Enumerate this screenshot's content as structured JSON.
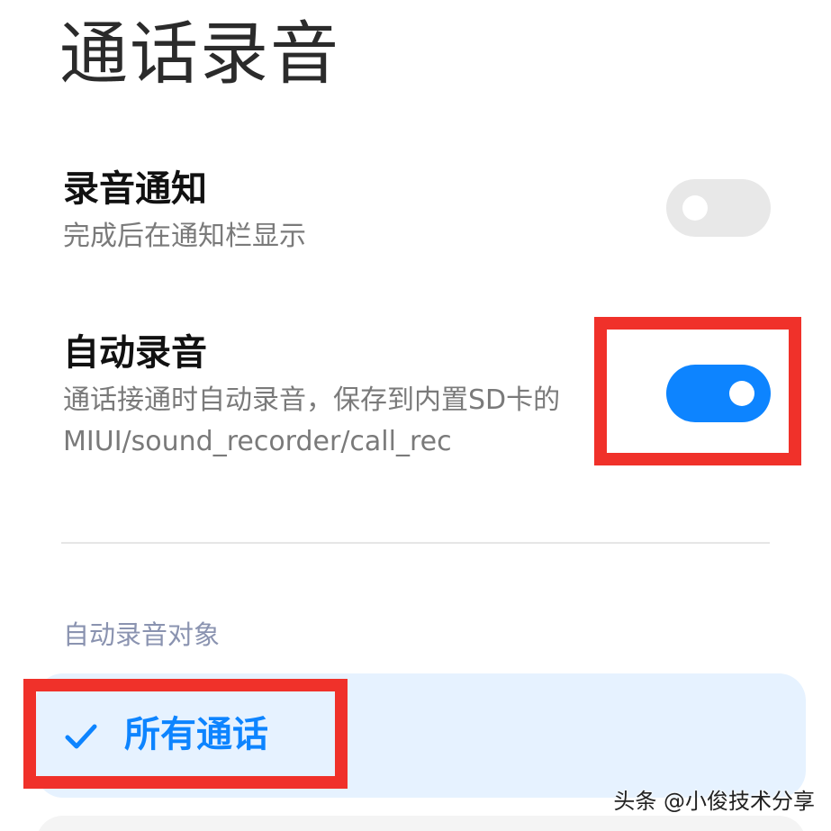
{
  "header": {
    "title": "通话录音"
  },
  "settings": {
    "record_notification": {
      "title": "录音通知",
      "description": "完成后在通知栏显示",
      "enabled": false
    },
    "auto_record": {
      "title": "自动录音",
      "description": "通话接通时自动录音，保存到内置SD卡的 MIUI/sound_recorder/call_rec",
      "enabled": true
    }
  },
  "auto_record_target": {
    "section_label": "自动录音对象",
    "selected_option": "所有通话",
    "check_icon": "check-icon"
  },
  "watermark": {
    "text": "头条 @小俊技术分享"
  },
  "colors": {
    "accent": "#0d84ff",
    "highlight_box": "#f0312a",
    "toggle_off": "#e8e8e8",
    "selected_bg": "#e6f2ff"
  }
}
